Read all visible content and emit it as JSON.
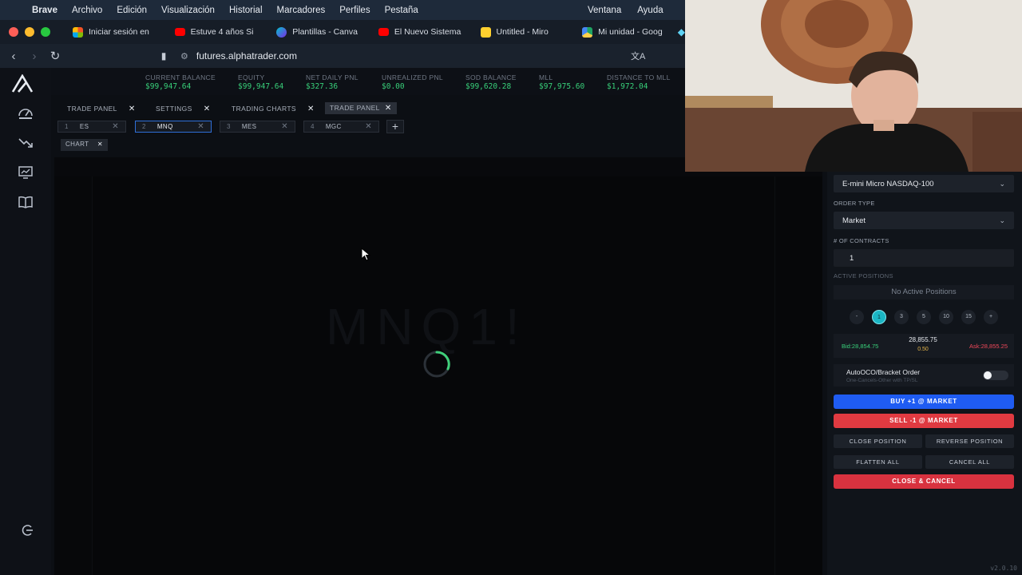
{
  "menubar": {
    "app": "Brave",
    "items": [
      "Archivo",
      "Edición",
      "Visualización",
      "Historial",
      "Marcadores",
      "Perfiles",
      "Pestaña"
    ],
    "right_items": [
      "Ventana",
      "Ayuda"
    ]
  },
  "browser_tabs": [
    {
      "label": "Iniciar sesión en",
      "icon": "windows-logo-icon",
      "color": "#f35325"
    },
    {
      "label": "Estuve 4 años Si",
      "icon": "youtube-icon",
      "color": "#ff0000"
    },
    {
      "label": "Plantillas - Canva",
      "icon": "canva-icon",
      "color": "#7d2ae8"
    },
    {
      "label": "El Nuevo Sistema",
      "icon": "youtube-icon",
      "color": "#ff0000"
    },
    {
      "label": "Untitled - Miro",
      "icon": "miro-icon",
      "color": "#ffd02f"
    },
    {
      "label": "Mi unidad - Goog",
      "icon": "google-drive-icon",
      "color": "#1fa463"
    }
  ],
  "address": {
    "url": "futures.alphatrader.com"
  },
  "stats": [
    {
      "label": "CURRENT BALANCE",
      "value": "$99,947.64"
    },
    {
      "label": "EQUITY",
      "value": "$99,947.64"
    },
    {
      "label": "NET DAILY PNL",
      "value": "$327.36"
    },
    {
      "label": "UNREALIZED PNL",
      "value": "$0.00"
    },
    {
      "label": "SOD BALANCE",
      "value": "$99,620.28"
    },
    {
      "label": "MLL",
      "value": "$97,975.60"
    },
    {
      "label": "DISTANCE TO MLL",
      "value": "$1,972.04"
    }
  ],
  "panel_tabs": [
    {
      "label": "TRADE PANEL"
    },
    {
      "label": "SETTINGS"
    },
    {
      "label": "TRADING CHARTS"
    },
    {
      "label": "TRADE PANEL"
    }
  ],
  "symbol_tabs": [
    {
      "num": "1",
      "label": "ES"
    },
    {
      "num": "2",
      "label": "MNQ"
    },
    {
      "num": "3",
      "label": "MES"
    },
    {
      "num": "4",
      "label": "MGC"
    }
  ],
  "chart_tab": {
    "label": "CHART"
  },
  "order": {
    "instrument": "E-mini Micro NASDAQ-100",
    "order_type_label": "ORDER TYPE",
    "order_type": "Market",
    "contracts_label": "# OF CONTRACTS",
    "contracts": "1",
    "active_positions_label": "ACTIVE POSITIONS",
    "no_positions": "No Active Positions",
    "qty_options": [
      "-",
      "1",
      "3",
      "5",
      "10",
      "15",
      "+"
    ],
    "bid": "Bid:28,854.75",
    "mid": "28,855.75",
    "spread": "0.50",
    "ask": "Ask:28,855.25",
    "oco_title": "AutoOCO/Bracket Order",
    "oco_sub": "One-Cancels-Other with TP/SL",
    "oco_enabled": false,
    "buy": "BUY +1 @ MARKET",
    "sell": "SELL -1 @ MARKET",
    "close_position": "CLOSE POSITION",
    "reverse_position": "REVERSE POSITION",
    "flatten_all": "FLATTEN ALL",
    "cancel_all": "CANCEL ALL",
    "close_cancel": "CLOSE & CANCEL",
    "version": "v2.0.10"
  },
  "colors": {
    "positive": "#38d07a",
    "negative": "#f0485a",
    "buy": "#1f5cf2",
    "sell": "#e03a41",
    "accent": "#1bb6c4"
  }
}
